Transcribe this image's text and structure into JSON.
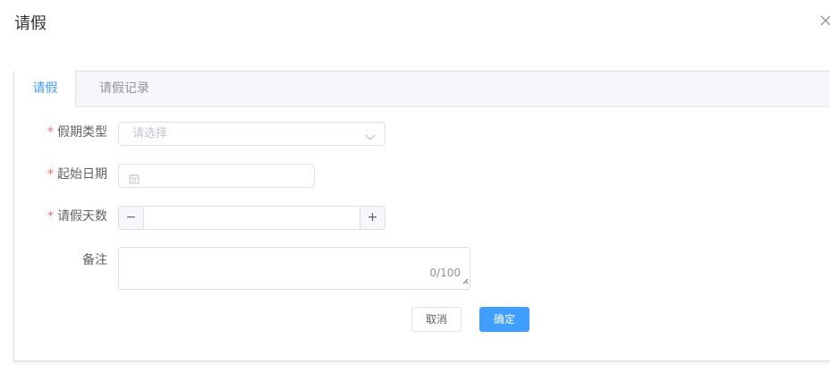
{
  "dialog": {
    "title": "请假",
    "close_icon": "close-icon"
  },
  "tabs": [
    {
      "label": "请假",
      "active": true
    },
    {
      "label": "请假记录",
      "active": false
    }
  ],
  "form": {
    "required_mark": "*",
    "leave_type": {
      "label": "假期类型",
      "placeholder": "请选择",
      "required": true
    },
    "start_date": {
      "label": "起始日期",
      "value": "",
      "required": true
    },
    "days": {
      "label": "请假天数",
      "value": "",
      "minus": "−",
      "plus": "+",
      "required": true
    },
    "remark": {
      "label": "备注",
      "value": "",
      "counter": "0/100",
      "required": false
    }
  },
  "buttons": {
    "cancel": "取消",
    "confirm": "确定"
  },
  "colors": {
    "primary": "#409eff",
    "required": "#f56c6c",
    "border": "#dcdfe6",
    "header_bg": "#f5f7fa"
  }
}
